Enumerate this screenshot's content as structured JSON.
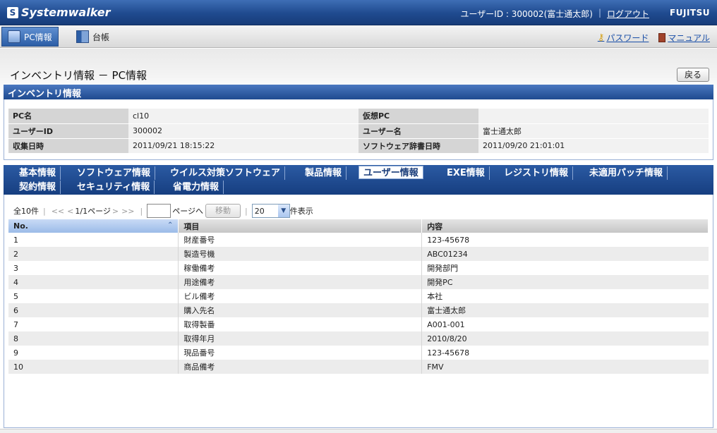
{
  "header": {
    "brand": "Systemwalker",
    "brand_mark": "S",
    "user_info": "ユーザーID : 300002(富士通太郎)",
    "logout": "ログアウト",
    "vendor": "FUJITSU"
  },
  "nav": {
    "tabs": [
      {
        "label": "PC情報",
        "icon": "pc-icon"
      },
      {
        "label": "台帳",
        "icon": "book-icon"
      }
    ],
    "password": "パスワード",
    "manual": "マニュアル"
  },
  "page": {
    "title": "インベントリ情報 － PC情報",
    "back_button": "戻る"
  },
  "inventory": {
    "section_title": "インベントリ情報",
    "rows": [
      {
        "label1": "PC名",
        "value1": "cl10",
        "label2": "仮想PC",
        "value2": ""
      },
      {
        "label1": "ユーザーID",
        "value1": "300002",
        "label2": "ユーザー名",
        "value2": "富士通太郎"
      },
      {
        "label1": "収集日時",
        "value1": "2011/09/21 18:15:22",
        "label2": "ソフトウェア辞書日時",
        "value2": "2011/09/20 21:01:01"
      }
    ]
  },
  "subtabs": {
    "row1": [
      "基本情報",
      "ソフトウェア情報",
      "ウイルス対策ソフトウェア",
      "製品情報",
      "ユーザー情報",
      "EXE情報",
      "レジストリ情報",
      "未適用パッチ情報"
    ],
    "row2": [
      "契約情報",
      "セキュリティ情報",
      "省電力情報"
    ],
    "active": "ユーザー情報"
  },
  "pager": {
    "total": "全10件",
    "first": "<<",
    "prev": "<",
    "page_info": "1/1ページ",
    "next": ">",
    "last": ">>",
    "page_input": "",
    "goto_label": "ページへ",
    "move_button": "移動",
    "per_page_value": "20",
    "per_page_suffix": "件表示"
  },
  "table": {
    "columns": [
      "No.",
      "項目",
      "内容"
    ],
    "rows": [
      [
        "1",
        "財産番号",
        "123-45678"
      ],
      [
        "2",
        "製造号機",
        "ABC01234"
      ],
      [
        "3",
        "稼働備考",
        "開発部門"
      ],
      [
        "4",
        "用途備考",
        "開発PC"
      ],
      [
        "5",
        "ビル備考",
        "本社"
      ],
      [
        "6",
        "購入先名",
        "富士通太郎"
      ],
      [
        "7",
        "取得製番",
        "A001-001"
      ],
      [
        "8",
        "取得年月",
        "2010/8/20"
      ],
      [
        "9",
        "現品番号",
        "123-45678"
      ],
      [
        "10",
        "商品備考",
        "FMV"
      ]
    ]
  }
}
